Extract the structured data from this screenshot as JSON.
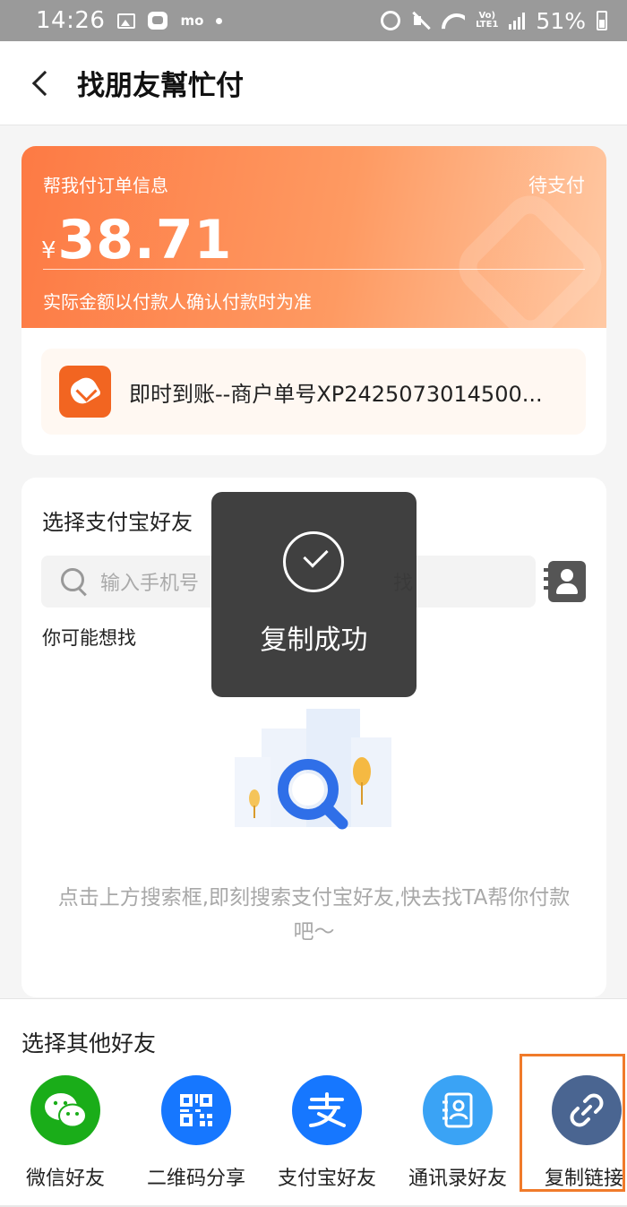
{
  "status_bar": {
    "time": "14:26",
    "mo": "mo",
    "lte": "LTE1",
    "vo": "Vo)",
    "battery": "51%"
  },
  "nav": {
    "title": "找朋友幫忙付"
  },
  "order": {
    "label": "帮我付订单信息",
    "status": "待支付",
    "currency": "¥",
    "amount": "38.71",
    "note": "实际金额以付款人确认付款时为准",
    "merchant": "即时到账--商户单号XP2425073014500..."
  },
  "friends": {
    "title": "选择支付宝好友",
    "search_placeholder": "输入手机号",
    "search_suffix": "找",
    "maybe_label": "你可能想找",
    "empty_text": "点击上方搜索框,即刻搜索支付宝好友,快去找TA帮你付款吧～"
  },
  "toast": {
    "text": "复制成功"
  },
  "share": {
    "title": "选择其他好友",
    "items": [
      {
        "label": "微信好友",
        "icon": "wechat-icon",
        "color": "#1aad19"
      },
      {
        "label": "二维码分享",
        "icon": "qr-code-icon",
        "color": "#1677ff"
      },
      {
        "label": "支付宝好友",
        "icon": "alipay-icon",
        "color": "#1677ff"
      },
      {
        "label": "通讯录好友",
        "icon": "contacts-book-icon",
        "color": "#3aa3f5"
      },
      {
        "label": "复制链接",
        "icon": "link-icon",
        "color": "#4a6591"
      }
    ]
  },
  "colors": {
    "accent": "#fd7a44",
    "highlight": "#f07a2a"
  }
}
